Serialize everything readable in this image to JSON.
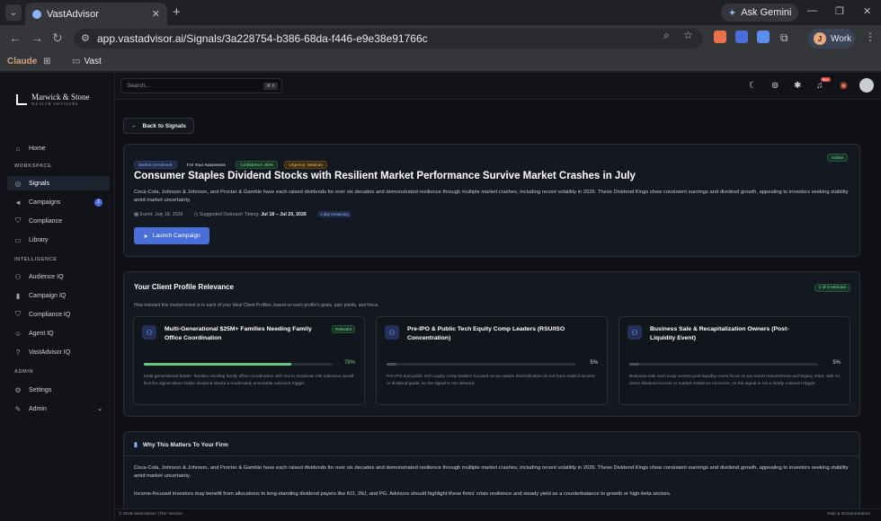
{
  "browser": {
    "tab_title": "VastAdvisor",
    "url": "app.vastadvisor.ai/Signals/3a228754-b386-68da-f446-e9e38e91766c",
    "ask_gemini": "Ask Gemini",
    "profile_initial": "J",
    "profile_label": "Work",
    "bookmarks": [
      "Claude",
      "Vast"
    ]
  },
  "sidebar": {
    "brand": "Marwick & Stone",
    "brand_sub": "WEALTH ADVISORS",
    "home": "Home",
    "sections": [
      "WORKSPACE",
      "INTELLIGENCE",
      "ADMIN"
    ],
    "workspace": [
      {
        "label": "Signals",
        "icon": "signal-icon"
      },
      {
        "label": "Campaigns",
        "icon": "megaphone-icon",
        "badge": "2"
      },
      {
        "label": "Compliance",
        "icon": "shield-icon"
      },
      {
        "label": "Library",
        "icon": "folder-icon"
      }
    ],
    "intelligence": [
      {
        "label": "Audience IQ",
        "icon": "users-icon"
      },
      {
        "label": "Campaign IQ",
        "icon": "bar-chart-icon"
      },
      {
        "label": "Compliance IQ",
        "icon": "shield-check-icon"
      },
      {
        "label": "Agent IQ",
        "icon": "user-icon"
      },
      {
        "label": "VastAdvisor IQ",
        "icon": "help-icon"
      }
    ],
    "admin": [
      {
        "label": "Settings",
        "icon": "gear-icon"
      },
      {
        "label": "Admin",
        "icon": "wrench-icon"
      }
    ]
  },
  "topbar": {
    "search_placeholder": "Search...",
    "search_shortcut": "⌘ K",
    "notif_count": "99+"
  },
  "signal": {
    "back_label": "Back to Signals",
    "tags": [
      "Market Sentiment",
      "For Your Awareness",
      "Confidence: 90%",
      "Urgency: Medium"
    ],
    "status": "Active",
    "title": "Consumer Staples Dividend Stocks with Resilient Market Performance Survive Market Crashes in July",
    "description": "Coca-Cola, Johnson & Johnson, and Procter & Gamble have each raised dividends for over six decades and demonstrated resilience through multiple market crashes, including recent volatility in 2026. These Dividend Kings show consistent earnings and dividend growth, appealing to investors seeking stability amid market uncertainty.",
    "event_label": "Event: July 18, 2026",
    "outreach_label": "Suggested Outreach Timing:",
    "outreach_value": "Jul 18 – Jul 20, 2026",
    "remaining": "1 day remaining",
    "launch_label": "Launch Campaign"
  },
  "relevance": {
    "title": "Your Client Profile Relevance",
    "subtitle": "How relevant this market event is to each of your Ideal Client Profiles, based on each profile's goals, pain points, and focus.",
    "badge": "1 of 3 relevant",
    "profiles": [
      {
        "name": "Multi-Generational $25M+ Families Needing Family Office Coordination",
        "relevant_label": "Relevant",
        "score": 78,
        "score_label": "78%",
        "description": "Multi-generational $25M+ families needing family office coordination with low to moderate risk tolerance would find the signal about stable dividend stocks a moderately actionable outreach trigger."
      },
      {
        "name": "Pre-IPO & Public Tech Equity Comp Leaders (RSU/ISO Concentration)",
        "relevant_label": "",
        "score": 5,
        "score_label": "5%",
        "description": "Pre-IPO and public tech equity comp leaders focused on tax-aware diversification do not have explicit income or dividend goals, so the signal is not relevant."
      },
      {
        "name": "Business Sale & Recapitalization Owners (Post-Liquidity Event)",
        "relevant_label": "",
        "score": 5,
        "score_label": "5%",
        "description": "Business sale and recap owners post-liquidity event focus on tax-smart reinvestment and legacy reset, with no direct dividend income or market resilience concerns, so the signal is not a timely outreach trigger."
      }
    ]
  },
  "why": {
    "title": "Why This Matters To Your Firm",
    "p1": "Coca-Cola, Johnson & Johnson, and Procter & Gamble have each raised dividends for over six decades and demonstrated resilience through multiple market crashes, including recent volatility in 2026. These Dividend Kings show consistent earnings and dividend growth, appealing to investors seeking stability amid market uncertainty.",
    "p2": "Income-focused investors may benefit from allocations to long-standing dividend payers like KO, JNJ, and PG. Advisors should highlight these firms' crisis resilience and steady yield as a counterbalance to growth or high-beta sectors."
  },
  "footer": {
    "left": "© 2026 VastAdvisor | RIA Version",
    "right": "Help & Documentation"
  },
  "colors": {
    "accent": "#4a6fd8",
    "relevant_green": "#6cc57e",
    "background": "#0f1115"
  }
}
